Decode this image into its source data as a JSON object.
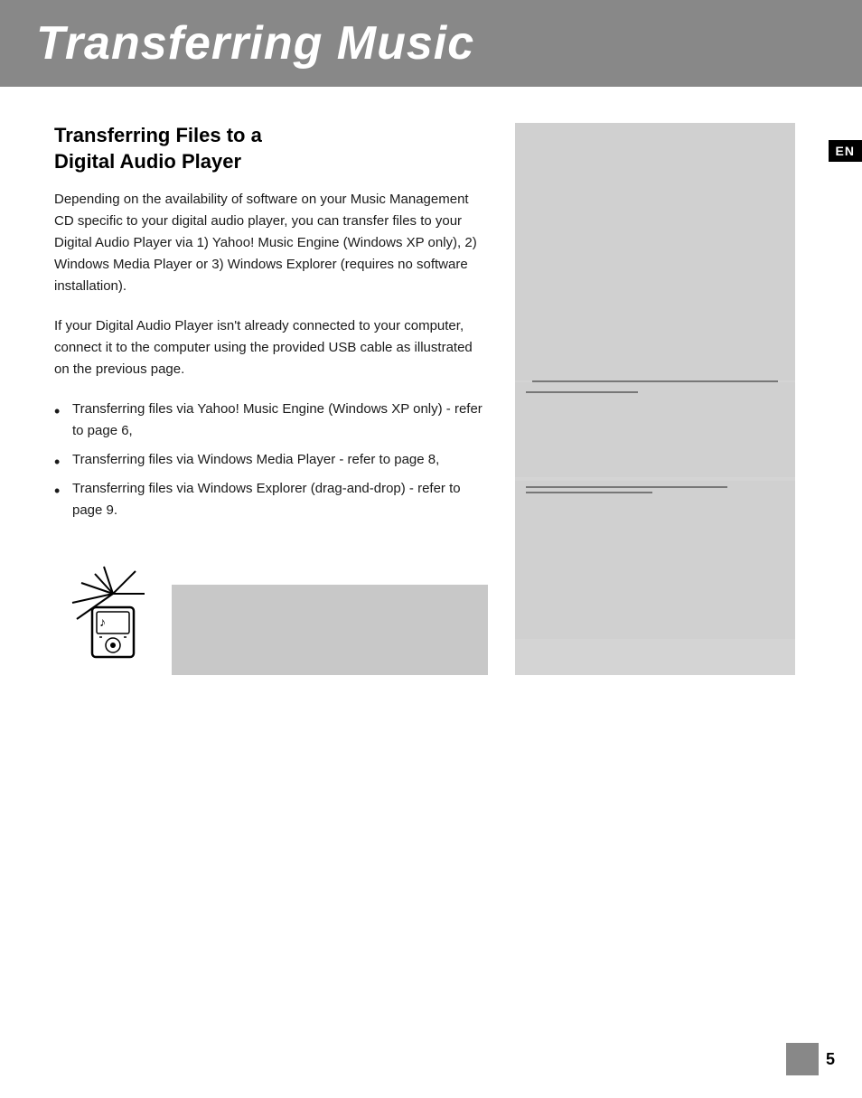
{
  "header": {
    "title": "Transferring Music"
  },
  "en_badge": "EN",
  "section": {
    "title_line1": "Transferring Files to a",
    "title_line2": "Digital Audio Player",
    "paragraph1": "Depending on the availability of software on your Music Management CD specific to your digital audio player, you can transfer files to your Digital Audio Player via 1) Yahoo! Music Engine (Windows XP only), 2) Windows Media Player or 3) Windows Explorer (requires no software installation).",
    "paragraph2": "If your Digital Audio Player isn't already connected to your computer, connect it to the computer using the provided USB cable as illustrated on the previous page.",
    "bullets": [
      "Transferring files via Yahoo! Music Engine (Windows XP only) - refer to page 6,",
      "Transferring files via Windows Media Player - refer to page 8,",
      "Transferring files via Windows Explorer (drag-and-drop) - refer to page 9."
    ]
  },
  "page_number": "5"
}
